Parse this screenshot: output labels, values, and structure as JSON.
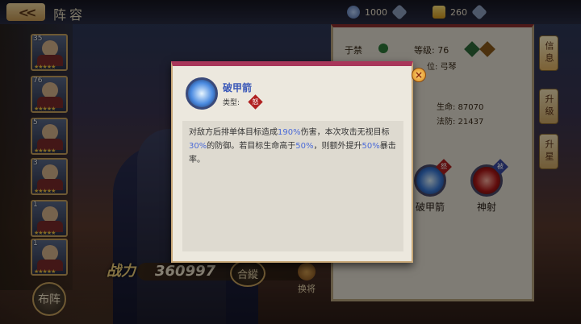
{
  "topbar": {
    "back_label": "<<",
    "title": "阵容",
    "stamina_value": "1000",
    "gold_value": "260"
  },
  "heroes": [
    {
      "level": "35",
      "stars": "★★★★★"
    },
    {
      "level": "76",
      "stars": "★★★★★"
    },
    {
      "level": "5",
      "stars": "★★★★★"
    },
    {
      "level": "3",
      "stars": "★★★★★"
    },
    {
      "level": "1",
      "stars": "★★★★★"
    },
    {
      "level": "1",
      "stars": "★★★★★"
    }
  ],
  "arrange_label": "布阵",
  "power": {
    "label": "战力",
    "value": "360997"
  },
  "fate_label": "合縱",
  "swap_label": "换将",
  "info": {
    "name": "于禁",
    "level": "等级: 76",
    "class": "位: 弓琴",
    "hp": "生命: 87070",
    "def": "法防: 21437"
  },
  "skills": [
    {
      "name": "破甲箭",
      "tag": "怒"
    },
    {
      "name": "神射",
      "tag": "被"
    }
  ],
  "side_tabs": {
    "info": "信息",
    "upgrade": "升级",
    "star": "升星"
  },
  "tooltip": {
    "title": "破甲箭",
    "type_label": "类型:",
    "type_badge": "怒",
    "desc_1": "对敌方后排单体目标造成",
    "desc_pct1": "190%",
    "desc_2": "伤害，本次攻击无视目标",
    "desc_pct2": "30%",
    "desc_3": "的防御。若目标生命高于",
    "desc_pct3": "50%",
    "desc_4": "，则额外提升",
    "desc_pct4": "50%",
    "desc_5": "暴击率。",
    "close_label": "×"
  }
}
